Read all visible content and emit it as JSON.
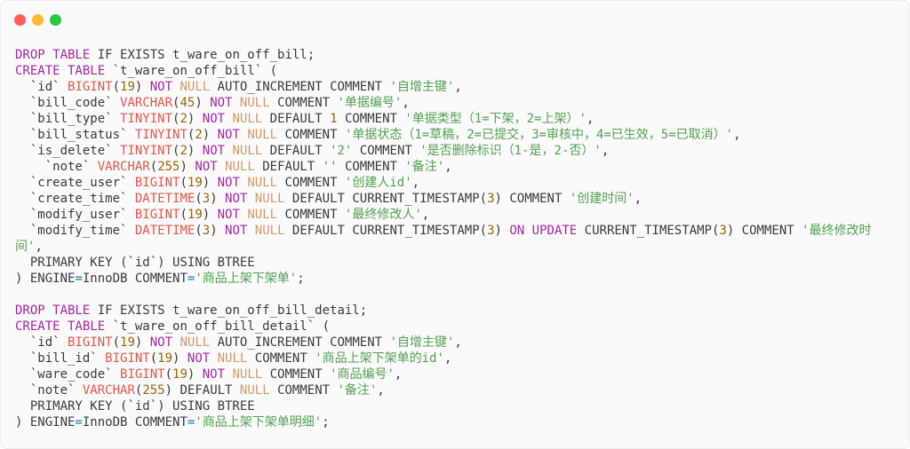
{
  "window": {
    "controls": [
      {
        "name": "close",
        "color": "#ff5f57"
      },
      {
        "name": "minimize",
        "color": "#febc2e"
      },
      {
        "name": "maximize",
        "color": "#28c840"
      }
    ]
  },
  "code": {
    "language": "sql",
    "lines": [
      [
        [
          "kw",
          "DROP TABLE"
        ],
        [
          "tx",
          " IF EXISTS t_ware_on_off_bill;"
        ]
      ],
      [
        [
          "kw",
          "CREATE TABLE"
        ],
        [
          "tx",
          " `t_ware_on_off_bill` ("
        ]
      ],
      [
        [
          "tx",
          "  `id` "
        ],
        [
          "ty",
          "BIGINT"
        ],
        [
          "tx",
          "("
        ],
        [
          "num",
          "19"
        ],
        [
          "tx",
          ") "
        ],
        [
          "kw",
          "NOT"
        ],
        [
          "tx",
          " "
        ],
        [
          "nul",
          "NULL"
        ],
        [
          "tx",
          " AUTO_INCREMENT COMMENT "
        ],
        [
          "str",
          "'自增主键'"
        ],
        [
          "tx",
          ","
        ]
      ],
      [
        [
          "tx",
          "  `bill_code` "
        ],
        [
          "ty",
          "VARCHAR"
        ],
        [
          "tx",
          "("
        ],
        [
          "num",
          "45"
        ],
        [
          "tx",
          ") "
        ],
        [
          "kw",
          "NOT"
        ],
        [
          "tx",
          " "
        ],
        [
          "nul",
          "NULL"
        ],
        [
          "tx",
          " COMMENT "
        ],
        [
          "str",
          "'单据编号'"
        ],
        [
          "tx",
          ","
        ]
      ],
      [
        [
          "tx",
          "  `bill_type` "
        ],
        [
          "ty",
          "TINYINT"
        ],
        [
          "tx",
          "("
        ],
        [
          "num",
          "2"
        ],
        [
          "tx",
          ") "
        ],
        [
          "kw",
          "NOT"
        ],
        [
          "tx",
          " "
        ],
        [
          "nul",
          "NULL"
        ],
        [
          "tx",
          " DEFAULT "
        ],
        [
          "num",
          "1"
        ],
        [
          "tx",
          " COMMENT "
        ],
        [
          "str",
          "'单据类型（1=下架，2=上架）'"
        ],
        [
          "tx",
          ","
        ]
      ],
      [
        [
          "tx",
          "  `bill_status` "
        ],
        [
          "ty",
          "TINYINT"
        ],
        [
          "tx",
          "("
        ],
        [
          "num",
          "2"
        ],
        [
          "tx",
          ") "
        ],
        [
          "kw",
          "NOT"
        ],
        [
          "tx",
          " "
        ],
        [
          "nul",
          "NULL"
        ],
        [
          "tx",
          " COMMENT "
        ],
        [
          "str",
          "'单据状态（1=草稿，2=已提交，3=审核中，4=已生效，5=已取消）'"
        ],
        [
          "tx",
          ","
        ]
      ],
      [
        [
          "tx",
          "  `is_delete` "
        ],
        [
          "ty",
          "TINYINT"
        ],
        [
          "tx",
          "("
        ],
        [
          "num",
          "2"
        ],
        [
          "tx",
          ") "
        ],
        [
          "kw",
          "NOT"
        ],
        [
          "tx",
          " "
        ],
        [
          "nul",
          "NULL"
        ],
        [
          "tx",
          " DEFAULT "
        ],
        [
          "str",
          "'2'"
        ],
        [
          "tx",
          " COMMENT "
        ],
        [
          "str",
          "'是否删除标识（1-是，2-否）'"
        ],
        [
          "tx",
          ","
        ]
      ],
      [
        [
          "tx",
          "    `note` "
        ],
        [
          "ty",
          "VARCHAR"
        ],
        [
          "tx",
          "("
        ],
        [
          "num",
          "255"
        ],
        [
          "tx",
          ") "
        ],
        [
          "kw",
          "NOT"
        ],
        [
          "tx",
          " "
        ],
        [
          "nul",
          "NULL"
        ],
        [
          "tx",
          " DEFAULT "
        ],
        [
          "str",
          "''"
        ],
        [
          "tx",
          " COMMENT "
        ],
        [
          "str",
          "'备注'"
        ],
        [
          "tx",
          ","
        ]
      ],
      [
        [
          "tx",
          "  `create_user` "
        ],
        [
          "ty",
          "BIGINT"
        ],
        [
          "tx",
          "("
        ],
        [
          "num",
          "19"
        ],
        [
          "tx",
          ") "
        ],
        [
          "kw",
          "NOT"
        ],
        [
          "tx",
          " "
        ],
        [
          "nul",
          "NULL"
        ],
        [
          "tx",
          " COMMENT "
        ],
        [
          "str",
          "'创建人id'"
        ],
        [
          "tx",
          ","
        ]
      ],
      [
        [
          "tx",
          "  `create_time` "
        ],
        [
          "ty",
          "DATETIME"
        ],
        [
          "tx",
          "("
        ],
        [
          "num",
          "3"
        ],
        [
          "tx",
          ") "
        ],
        [
          "kw",
          "NOT"
        ],
        [
          "tx",
          " "
        ],
        [
          "nul",
          "NULL"
        ],
        [
          "tx",
          " DEFAULT CURRENT_TIMESTAMP("
        ],
        [
          "num",
          "3"
        ],
        [
          "tx",
          ") COMMENT "
        ],
        [
          "str",
          "'创建时间'"
        ],
        [
          "tx",
          ","
        ]
      ],
      [
        [
          "tx",
          "  `modify_user` "
        ],
        [
          "ty",
          "BIGINT"
        ],
        [
          "tx",
          "("
        ],
        [
          "num",
          "19"
        ],
        [
          "tx",
          ") "
        ],
        [
          "kw",
          "NOT"
        ],
        [
          "tx",
          " "
        ],
        [
          "nul",
          "NULL"
        ],
        [
          "tx",
          " COMMENT "
        ],
        [
          "str",
          "'最终修改人'"
        ],
        [
          "tx",
          ","
        ]
      ],
      [
        [
          "tx",
          "  `modify_time` "
        ],
        [
          "ty",
          "DATETIME"
        ],
        [
          "tx",
          "("
        ],
        [
          "num",
          "3"
        ],
        [
          "tx",
          ") "
        ],
        [
          "kw",
          "NOT"
        ],
        [
          "tx",
          " "
        ],
        [
          "nul",
          "NULL"
        ],
        [
          "tx",
          " DEFAULT CURRENT_TIMESTAMP("
        ],
        [
          "num",
          "3"
        ],
        [
          "tx",
          ") "
        ],
        [
          "kw",
          "ON UPDATE"
        ],
        [
          "tx",
          " CURRENT_TIMESTAMP("
        ],
        [
          "num",
          "3"
        ],
        [
          "tx",
          ") COMMENT "
        ],
        [
          "str",
          "'最终修改时间'"
        ],
        [
          "tx",
          ","
        ]
      ],
      [
        [
          "tx",
          "  PRIMARY KEY (`id`) USING BTREE"
        ]
      ],
      [
        [
          "tx",
          ") ENGINE"
        ],
        [
          "op",
          "="
        ],
        [
          "tx",
          "InnoDB COMMENT"
        ],
        [
          "op",
          "="
        ],
        [
          "str",
          "'商品上架下架单'"
        ],
        [
          "tx",
          ";"
        ]
      ],
      [
        [
          "tx",
          ""
        ]
      ],
      [
        [
          "kw",
          "DROP TABLE"
        ],
        [
          "tx",
          " IF EXISTS t_ware_on_off_bill_detail;"
        ]
      ],
      [
        [
          "kw",
          "CREATE TABLE"
        ],
        [
          "tx",
          " `t_ware_on_off_bill_detail` ("
        ]
      ],
      [
        [
          "tx",
          "  `id` "
        ],
        [
          "ty",
          "BIGINT"
        ],
        [
          "tx",
          "("
        ],
        [
          "num",
          "19"
        ],
        [
          "tx",
          ") "
        ],
        [
          "kw",
          "NOT"
        ],
        [
          "tx",
          " "
        ],
        [
          "nul",
          "NULL"
        ],
        [
          "tx",
          " AUTO_INCREMENT COMMENT "
        ],
        [
          "str",
          "'自增主键'"
        ],
        [
          "tx",
          ","
        ]
      ],
      [
        [
          "tx",
          "  `bill_id` "
        ],
        [
          "ty",
          "BIGINT"
        ],
        [
          "tx",
          "("
        ],
        [
          "num",
          "19"
        ],
        [
          "tx",
          ") "
        ],
        [
          "kw",
          "NOT"
        ],
        [
          "tx",
          " "
        ],
        [
          "nul",
          "NULL"
        ],
        [
          "tx",
          " COMMENT "
        ],
        [
          "str",
          "'商品上架下架单的id'"
        ],
        [
          "tx",
          ","
        ]
      ],
      [
        [
          "tx",
          "  `ware_code` "
        ],
        [
          "ty",
          "BIGINT"
        ],
        [
          "tx",
          "("
        ],
        [
          "num",
          "19"
        ],
        [
          "tx",
          ") "
        ],
        [
          "kw",
          "NOT"
        ],
        [
          "tx",
          " "
        ],
        [
          "nul",
          "NULL"
        ],
        [
          "tx",
          " COMMENT "
        ],
        [
          "str",
          "'商品编号'"
        ],
        [
          "tx",
          ","
        ]
      ],
      [
        [
          "tx",
          "  `note` "
        ],
        [
          "ty",
          "VARCHAR"
        ],
        [
          "tx",
          "("
        ],
        [
          "num",
          "255"
        ],
        [
          "tx",
          ") DEFAULT "
        ],
        [
          "nul",
          "NULL"
        ],
        [
          "tx",
          " COMMENT "
        ],
        [
          "str",
          "'备注'"
        ],
        [
          "tx",
          ","
        ]
      ],
      [
        [
          "tx",
          "  PRIMARY KEY (`id`) USING BTREE"
        ]
      ],
      [
        [
          "tx",
          ") ENGINE"
        ],
        [
          "op",
          "="
        ],
        [
          "tx",
          "InnoDB COMMENT"
        ],
        [
          "op",
          "="
        ],
        [
          "str",
          "'商品上架下架单明细'"
        ],
        [
          "tx",
          ";"
        ]
      ]
    ]
  }
}
